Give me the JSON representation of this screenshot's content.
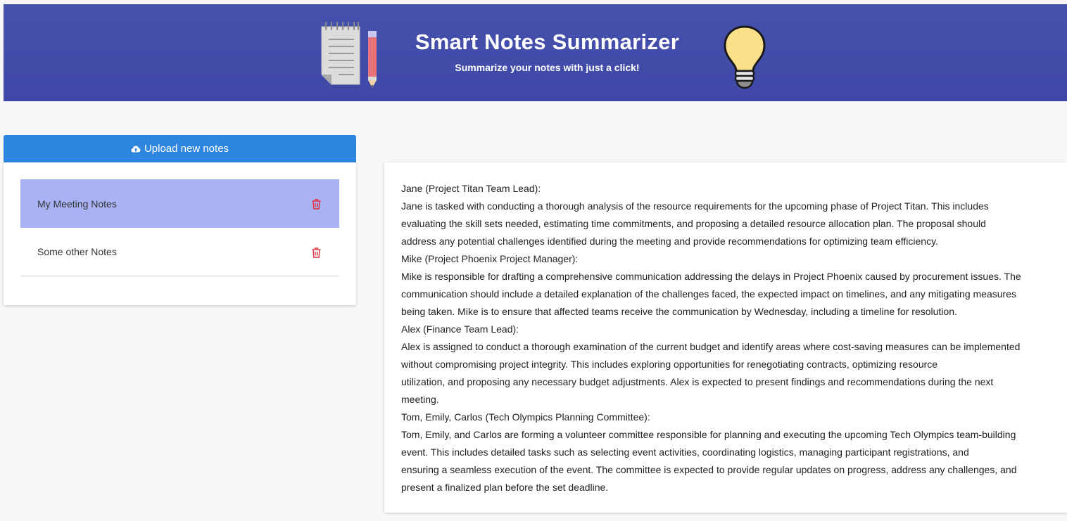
{
  "header": {
    "title": "Smart Notes Summarizer",
    "subtitle": "Summarize your notes with just a click!",
    "left_icon": "notepad-pencil-icon",
    "right_icon": "lightbulb-icon",
    "background_color": "#3f48a6"
  },
  "upload": {
    "label": "Upload new notes",
    "icon": "cloud-upload-icon",
    "color": "#2e86de"
  },
  "notes": {
    "items": [
      {
        "label": "My Meeting Notes",
        "selected": true
      },
      {
        "label": "Some other Notes",
        "selected": false
      }
    ],
    "selected_color": "#a9b2f3",
    "delete_icon": "trash-icon",
    "delete_color": "#e0323c"
  },
  "summary": {
    "lines": [
      "Jane (Project Titan Team Lead):",
      "Jane is tasked with conducting a thorough analysis of the resource requirements for the upcoming phase of Project Titan. This includes",
      "evaluating the skill sets needed, estimating time commitments, and proposing a detailed resource allocation plan. The proposal should",
      "address any potential challenges identified during the meeting and provide recommendations for optimizing team efficiency.",
      "Mike (Project Phoenix Project Manager):",
      "Mike is responsible for drafting a comprehensive communication addressing the delays in Project Phoenix caused by procurement issues. The",
      "communication should include a detailed explanation of the challenges faced, the expected impact on timelines, and any mitigating measures",
      "being taken. Mike is to ensure that affected teams receive the communication by Wednesday, including a timeline for resolution.",
      "Alex (Finance Team Lead):",
      "Alex is assigned to conduct a thorough examination of the current budget and identify areas where cost-saving measures can be implemented",
      "without compromising project integrity. This includes exploring opportunities for renegotiating contracts, optimizing resource",
      "utilization, and proposing any necessary budget adjustments. Alex is expected to present findings and recommendations during the next",
      "meeting.",
      "Tom, Emily, Carlos (Tech Olympics Planning Committee):",
      "Tom, Emily, and Carlos are forming a volunteer committee responsible for planning and executing the upcoming Tech Olympics team-building",
      "event. This includes detailed tasks such as selecting event activities, coordinating logistics, managing participant registrations, and",
      "ensuring a seamless execution of the event. The committee is expected to provide regular updates on progress, address any challenges, and",
      "present a finalized plan before the set deadline."
    ]
  }
}
